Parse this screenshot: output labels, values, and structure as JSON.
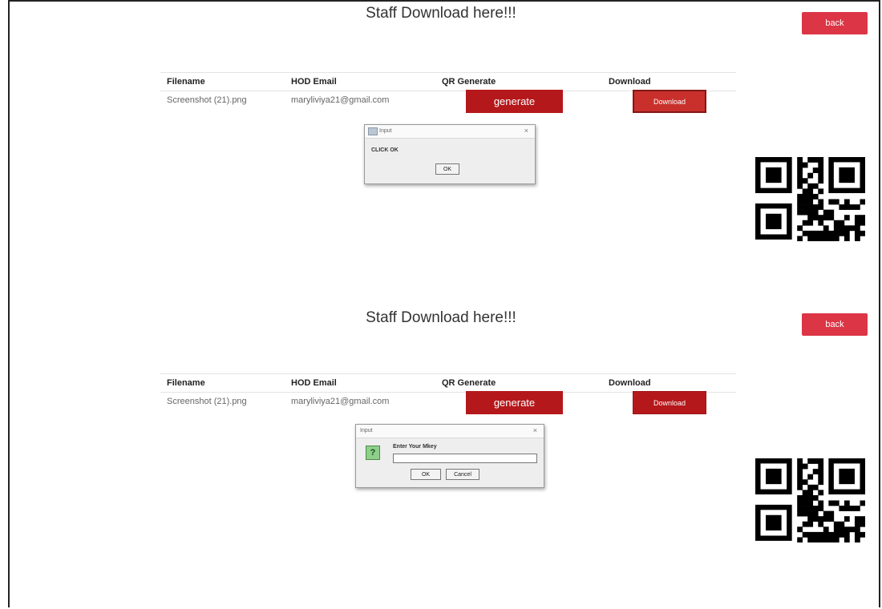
{
  "screens": [
    {
      "title": "Staff Download here!!!",
      "back_label": "back",
      "table": {
        "headers": [
          "Filename",
          "HOD Email",
          "QR Generate",
          "Download"
        ],
        "rows": [
          {
            "filename": "Screenshot (21).png",
            "email": "maryliviya21@gmail.com",
            "generate_label": "generate",
            "download_label": "Download"
          }
        ]
      },
      "dialog": {
        "title": "Input",
        "message": "CLICK OK",
        "ok_label": "OK"
      }
    },
    {
      "title": "Staff Download here!!!",
      "back_label": "back",
      "table": {
        "headers": [
          "Filename",
          "HOD Email",
          "QR Generate",
          "Download"
        ],
        "rows": [
          {
            "filename": "Screenshot (21).png",
            "email": "maryliviya21@gmail.com",
            "generate_label": "generate",
            "download_label": "Download"
          }
        ]
      },
      "dialog": {
        "title": "Input",
        "message": "Enter Your Mkey",
        "icon_glyph": "?",
        "input_value": "",
        "ok_label": "OK",
        "cancel_label": "Cancel"
      }
    }
  ],
  "colors": {
    "primary_red": "#b5181b",
    "back_red": "#dc3545"
  },
  "icons": {
    "qr": "qr-code-icon",
    "dialog_question": "question-icon",
    "dialog_close": "close-icon"
  }
}
